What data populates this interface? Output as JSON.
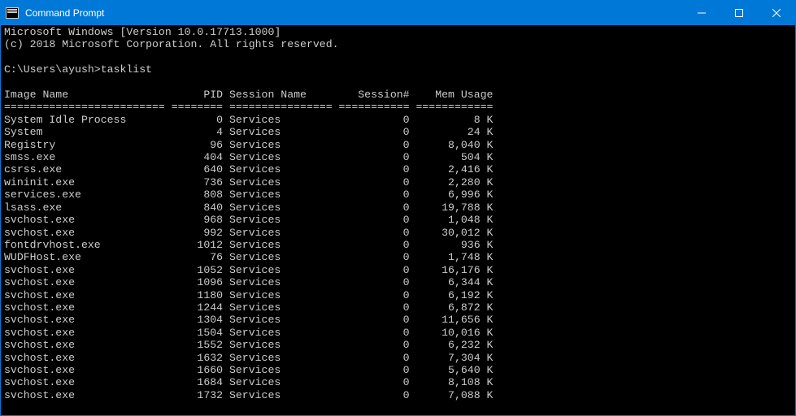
{
  "titlebar": {
    "title": "Command Prompt"
  },
  "terminal": {
    "line1": "Microsoft Windows [Version 10.0.17713.1000]",
    "line2": "(c) 2018 Microsoft Corporation. All rights reserved.",
    "prompt_line": "C:\\Users\\ayush>tasklist",
    "header": {
      "c1": "Image Name",
      "c2": "PID",
      "c3": "Session Name",
      "c4": "Session#",
      "c5": "Mem Usage"
    },
    "separator_segments": [
      "=========================",
      "========",
      "================",
      "===========",
      "============"
    ],
    "rows": [
      {
        "name": "System Idle Process",
        "pid": 0,
        "sess": "Services",
        "snum": 0,
        "mem": "8 K"
      },
      {
        "name": "System",
        "pid": 4,
        "sess": "Services",
        "snum": 0,
        "mem": "24 K"
      },
      {
        "name": "Registry",
        "pid": 96,
        "sess": "Services",
        "snum": 0,
        "mem": "8,040 K"
      },
      {
        "name": "smss.exe",
        "pid": 404,
        "sess": "Services",
        "snum": 0,
        "mem": "504 K"
      },
      {
        "name": "csrss.exe",
        "pid": 640,
        "sess": "Services",
        "snum": 0,
        "mem": "2,416 K"
      },
      {
        "name": "wininit.exe",
        "pid": 736,
        "sess": "Services",
        "snum": 0,
        "mem": "2,280 K"
      },
      {
        "name": "services.exe",
        "pid": 808,
        "sess": "Services",
        "snum": 0,
        "mem": "6,996 K"
      },
      {
        "name": "lsass.exe",
        "pid": 840,
        "sess": "Services",
        "snum": 0,
        "mem": "19,788 K"
      },
      {
        "name": "svchost.exe",
        "pid": 968,
        "sess": "Services",
        "snum": 0,
        "mem": "1,048 K"
      },
      {
        "name": "svchost.exe",
        "pid": 992,
        "sess": "Services",
        "snum": 0,
        "mem": "30,012 K"
      },
      {
        "name": "fontdrvhost.exe",
        "pid": 1012,
        "sess": "Services",
        "snum": 0,
        "mem": "936 K"
      },
      {
        "name": "WUDFHost.exe",
        "pid": 76,
        "sess": "Services",
        "snum": 0,
        "mem": "1,748 K"
      },
      {
        "name": "svchost.exe",
        "pid": 1052,
        "sess": "Services",
        "snum": 0,
        "mem": "16,176 K"
      },
      {
        "name": "svchost.exe",
        "pid": 1096,
        "sess": "Services",
        "snum": 0,
        "mem": "6,344 K"
      },
      {
        "name": "svchost.exe",
        "pid": 1180,
        "sess": "Services",
        "snum": 0,
        "mem": "6,192 K"
      },
      {
        "name": "svchost.exe",
        "pid": 1244,
        "sess": "Services",
        "snum": 0,
        "mem": "6,872 K"
      },
      {
        "name": "svchost.exe",
        "pid": 1304,
        "sess": "Services",
        "snum": 0,
        "mem": "11,656 K"
      },
      {
        "name": "svchost.exe",
        "pid": 1504,
        "sess": "Services",
        "snum": 0,
        "mem": "10,016 K"
      },
      {
        "name": "svchost.exe",
        "pid": 1552,
        "sess": "Services",
        "snum": 0,
        "mem": "6,232 K"
      },
      {
        "name": "svchost.exe",
        "pid": 1632,
        "sess": "Services",
        "snum": 0,
        "mem": "7,304 K"
      },
      {
        "name": "svchost.exe",
        "pid": 1660,
        "sess": "Services",
        "snum": 0,
        "mem": "5,640 K"
      },
      {
        "name": "svchost.exe",
        "pid": 1684,
        "sess": "Services",
        "snum": 0,
        "mem": "8,108 K"
      },
      {
        "name": "svchost.exe",
        "pid": 1732,
        "sess": "Services",
        "snum": 0,
        "mem": "7,088 K"
      }
    ]
  }
}
